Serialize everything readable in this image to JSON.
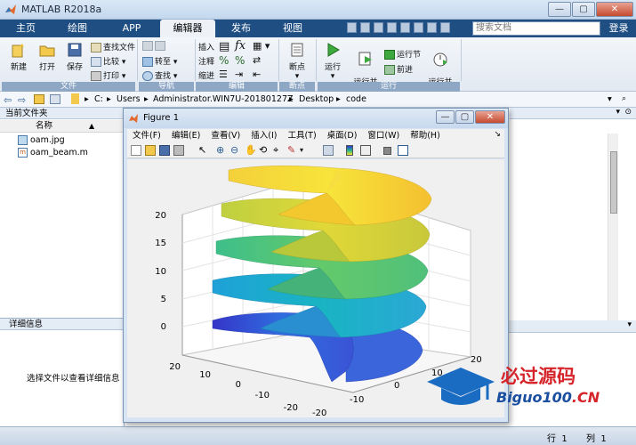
{
  "app": {
    "title": "MATLAB R2018a",
    "search_placeholder": "搜索文档",
    "login": "登录"
  },
  "tabs": [
    {
      "label": "主页"
    },
    {
      "label": "绘图"
    },
    {
      "label": "APP"
    },
    {
      "label": "编辑器"
    },
    {
      "label": "发布"
    },
    {
      "label": "视图"
    }
  ],
  "ribbon": {
    "file": {
      "new": "新建",
      "open": "打开",
      "save": "保存",
      "find_files": "查找文件",
      "compare": "比较",
      "print": "打印",
      "group": "文件"
    },
    "navigate": {
      "goto": "转至",
      "find": "查找",
      "group": "导航"
    },
    "edit": {
      "insert": "插入",
      "comment": "注释",
      "indent": "缩进",
      "group": "编辑"
    },
    "breakpoints": {
      "breakpoints": "断点",
      "group": "断点"
    },
    "run": {
      "run": "运行",
      "run_advance": "运行并\n前进",
      "run_section": "运行节",
      "advance": "前进",
      "run_time": "运行并\n计时",
      "group": "运行"
    }
  },
  "address": {
    "parts": [
      "C:",
      "Users",
      "Administrator.WIN7U-20180127Z",
      "Desktop",
      "code"
    ]
  },
  "left_panel": {
    "header": "当前文件夹",
    "col_name": "名称",
    "col_sort": "▲",
    "files": [
      {
        "name": "oam.jpg",
        "icon": "image-file-icon"
      },
      {
        "name": "oam_beam.m",
        "icon": "m-file-icon"
      }
    ],
    "detail_header": "详细信息",
    "detail_text": "选择文件以查看详细信息"
  },
  "status": {
    "row_label": "行",
    "row_value": "1",
    "col_label": "列",
    "col_value": "1"
  },
  "figure": {
    "title": "Figure 1",
    "menu": [
      "文件(F)",
      "编辑(E)",
      "查看(V)",
      "插入(I)",
      "工具(T)",
      "桌面(D)",
      "窗口(W)",
      "帮助(H)"
    ],
    "toolbar_icons": [
      "new-figure-icon",
      "open-file-icon",
      "save-figure-icon",
      "print-figure-icon",
      "pointer-icon",
      "zoom-in-icon",
      "zoom-out-icon",
      "pan-icon",
      "rotate-3d-icon",
      "data-cursor-icon",
      "brush-icon",
      "link-plot-icon",
      "colorbar-icon",
      "legend-icon",
      "hide-tools-icon",
      "show-tools-icon"
    ],
    "plot": {
      "z_ticks": [
        "0",
        "5",
        "10",
        "15",
        "20"
      ],
      "x_ticks": [
        "-20",
        "-10",
        "0",
        "10",
        "20"
      ],
      "y_ticks": [
        "20",
        "10",
        "0",
        "-10",
        "-20"
      ],
      "colormap": "parula"
    }
  },
  "watermark": {
    "cn": "必过源码",
    "en_main": "Biguo100",
    "en_suffix": ".CN"
  },
  "colors": {
    "ribbon_tab_bg": "#1f4e83",
    "accent": "#c54a2f"
  }
}
